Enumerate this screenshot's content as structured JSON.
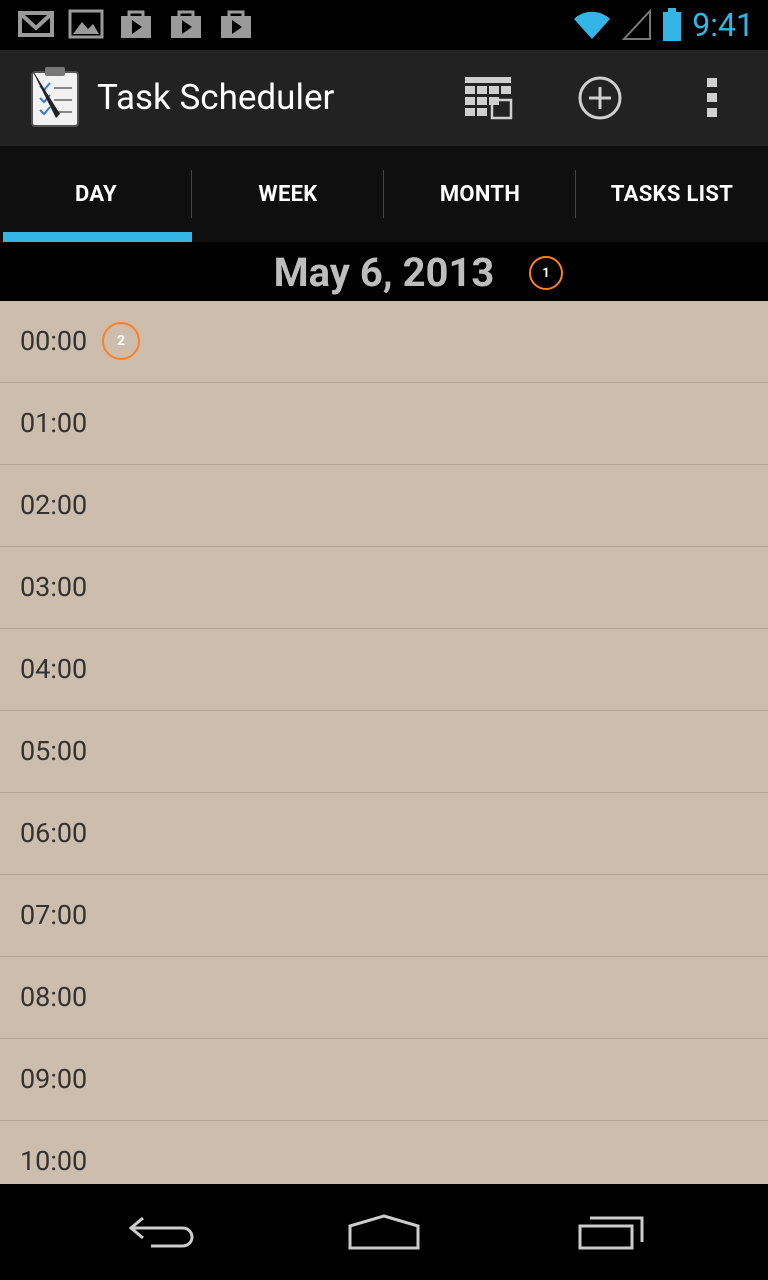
{
  "status_bar": {
    "time": "9:41",
    "notification_icons": [
      "gmail-icon",
      "gallery-icon",
      "play-store-icon",
      "play-store-icon",
      "play-store-icon"
    ],
    "accent_color": "#33b5e5"
  },
  "action_bar": {
    "title": "Task Scheduler",
    "actions": [
      "calendar-icon",
      "add-icon",
      "overflow-menu-icon"
    ]
  },
  "tabs": [
    {
      "label": "DAY",
      "selected": true
    },
    {
      "label": "WEEK",
      "selected": false
    },
    {
      "label": "MONTH",
      "selected": false
    },
    {
      "label": "TASKS LIST",
      "selected": false
    }
  ],
  "date_header": {
    "date": "May 6, 2013",
    "badge": "1"
  },
  "hours": [
    "00:00",
    "01:00",
    "02:00",
    "03:00",
    "04:00",
    "05:00",
    "06:00",
    "07:00",
    "08:00",
    "09:00",
    "10:00"
  ],
  "hour_badge": "2",
  "colors": {
    "list_background": "#cdbdac",
    "badge_ring": "#ff7f27"
  }
}
